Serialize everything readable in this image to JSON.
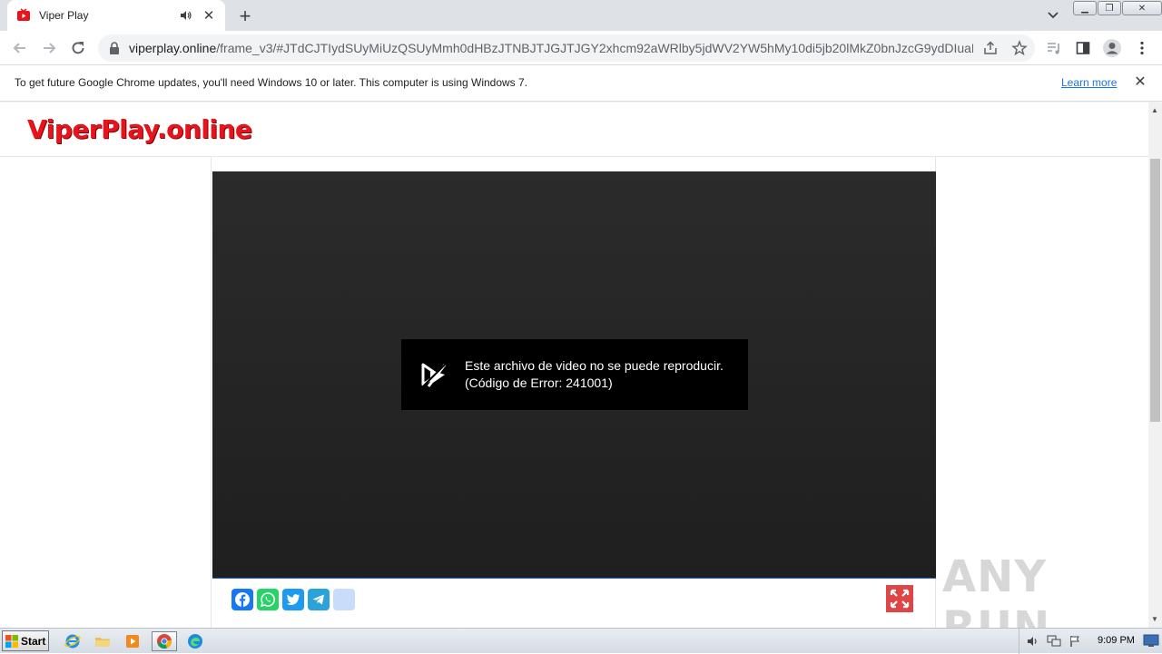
{
  "browser": {
    "tab": {
      "title": "Viper Play"
    },
    "url": {
      "host": "viperplay.online",
      "path": "/frame_v3/#JTdCJTIydSUyMiUzQSUyMmh0dHBzJTNBJTJGJTJGY2xhcm92aWRlby5jdWV2YW5hMy10di5jb20lMkZ0bnJzcG9ydDIuaHR..."
    }
  },
  "infobar": {
    "message": "To get future Google Chrome updates, you'll need Windows 10 or later. This computer is using Windows 7.",
    "link": "Learn more"
  },
  "site": {
    "logo": "ViperPlay.online"
  },
  "player": {
    "error_line1": "Este archivo de video no se puede reproducir.",
    "error_line2": "(Código de Error: 241001)"
  },
  "share": {
    "icons": [
      "facebook-icon",
      "whatsapp-icon",
      "twitter-icon",
      "telegram-icon",
      "share-icon"
    ]
  },
  "taskbar": {
    "start_label": "Start",
    "clock": "9:09 PM"
  },
  "watermark": "ANY RUN",
  "colors": {
    "logo": "#e8141c",
    "fullscreen": "#e04545",
    "facebook": "#1877f2",
    "whatsapp": "#25d366",
    "twitter": "#1d9bf0",
    "telegram": "#2aa3d9",
    "link": "#1a73e8"
  }
}
